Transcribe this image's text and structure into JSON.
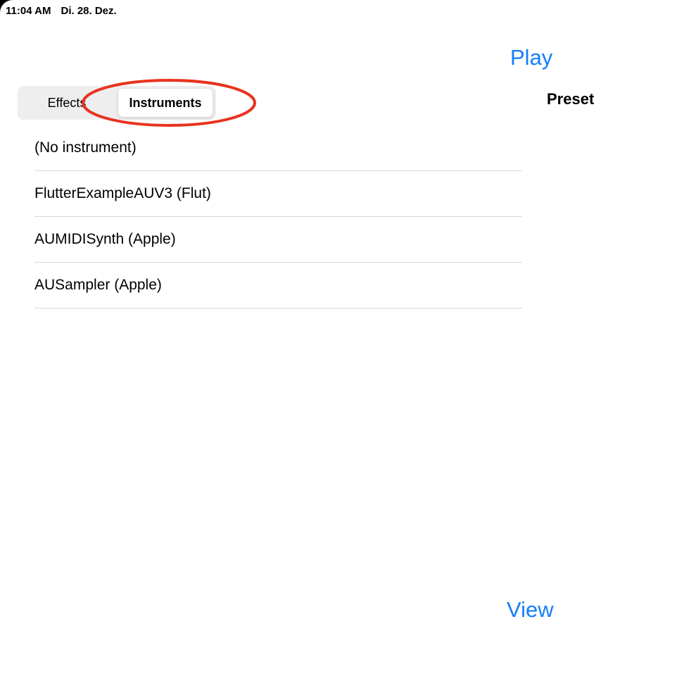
{
  "status_bar": {
    "time": "11:04 AM",
    "date": "Di. 28. Dez."
  },
  "header": {
    "play_label": "Play",
    "preset_label": "Preset"
  },
  "tabs": {
    "effects_label": "Effects",
    "instruments_label": "Instruments",
    "selected": "Instruments"
  },
  "instruments": [
    {
      "label": "(No instrument)"
    },
    {
      "label": "FlutterExampleAUV3 (Flut)"
    },
    {
      "label": "AUMIDISynth (Apple)"
    },
    {
      "label": "AUSampler (Apple)"
    }
  ],
  "footer": {
    "view_label": "View"
  },
  "colors": {
    "accent": "#147efb",
    "annotation": "#e8321e",
    "segment_background": "#eeeeef",
    "separator": "#d8d8dc"
  }
}
